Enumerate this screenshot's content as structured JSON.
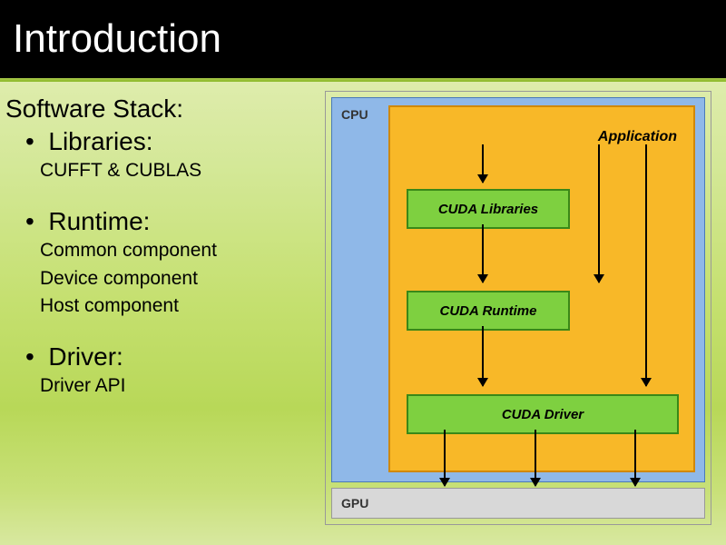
{
  "title": "Introduction",
  "left": {
    "heading": "Software Stack:",
    "items": [
      {
        "label": "Libraries:",
        "subs": [
          "CUFFT & CUBLAS"
        ]
      },
      {
        "label": "Runtime:",
        "subs": [
          "Common component",
          "Device component",
          "Host component"
        ]
      },
      {
        "label": "Driver:",
        "subs": [
          "Driver API"
        ]
      }
    ]
  },
  "diagram": {
    "cpu_label": "CPU",
    "gpu_label": "GPU",
    "app_label": "Application",
    "boxes": {
      "libraries": "CUDA Libraries",
      "runtime": "CUDA Runtime",
      "driver": "CUDA Driver"
    }
  }
}
